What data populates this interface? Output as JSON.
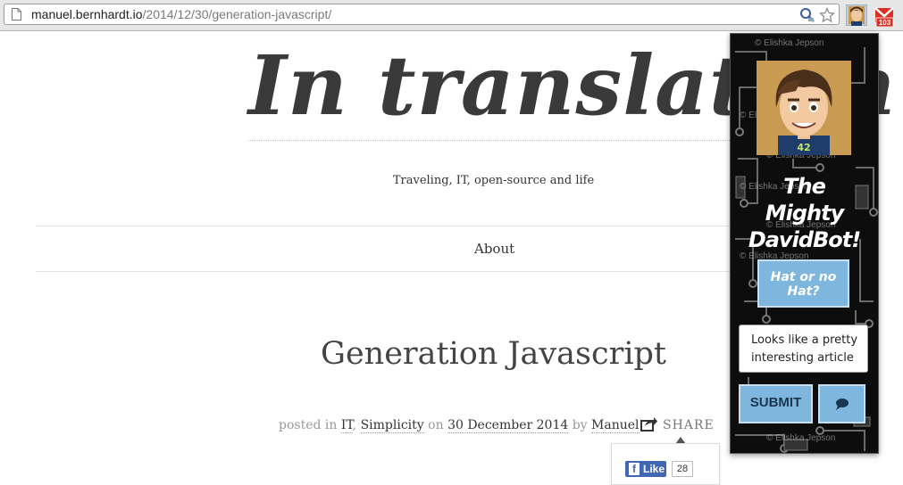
{
  "browser": {
    "url_host": "manuel.bernhardt.io",
    "url_path": "/2014/12/30/generation-javascript/",
    "mail_badge": "103"
  },
  "blog": {
    "title": "In translation",
    "tagline": "Traveling, IT, open-source and life",
    "nav": {
      "about": "About"
    }
  },
  "post": {
    "title": "Generation Javascript",
    "meta": {
      "posted_in": "posted in",
      "category_1": "IT",
      "sep": ",",
      "category_2": "Simplicity",
      "on": "on",
      "date": "30 December 2014",
      "by": "by",
      "author": "Manuel"
    },
    "share_label": "SHARE",
    "fb": {
      "like": "Like",
      "count": "28"
    }
  },
  "popup": {
    "watermark": "© Elishka Jepson",
    "bot_name_lines": [
      "The",
      "Mighty",
      "DavidBot!"
    ],
    "hat_button_lines": [
      "Hat or no",
      "Hat?"
    ],
    "message": "Looks like a pretty interesting article",
    "submit_label": "SUBMIT",
    "shirt_number": "42"
  },
  "colors": {
    "accent": "#7eb6de",
    "popup_bg": "#0d0d0d",
    "fb_blue": "#4267b2",
    "mail_red": "#d93025"
  }
}
